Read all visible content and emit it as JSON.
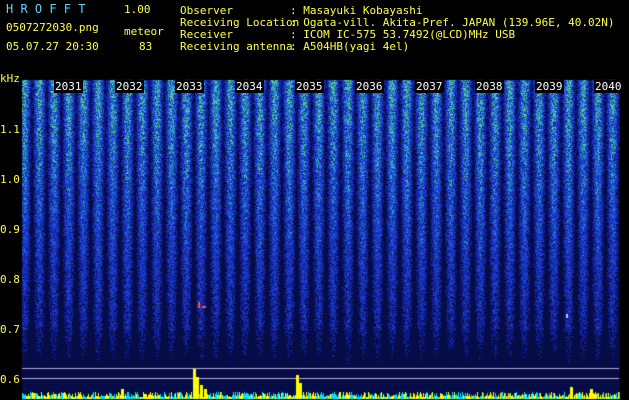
{
  "app": {
    "logo": "H R O F F T",
    "version": "1.00",
    "filename": "0507272030.png",
    "mode": "meteor",
    "datetime": "05.07.27 20:30",
    "count": "83"
  },
  "info": {
    "observer_label": "Observer",
    "observer_value": ": Masayuki Kobayashi",
    "location_label": "Receiving Location",
    "location_value": ": Ogata-vill. Akita-Pref. JAPAN (139.96E, 40.02N)",
    "receiver_label": "Receiver",
    "receiver_value": ": ICOM IC-575 53.7492(@LCD)MHz USB",
    "antenna_label": "Receiving antenna",
    "antenna_value": ": A504HB(yagi 4el)"
  },
  "axis": {
    "unit": "kHz",
    "y_ticks": [
      "1.1",
      "1.0",
      "0.9",
      "0.8",
      "0.7",
      "0.6"
    ],
    "time_ticks": [
      "2031",
      "2032",
      "2033",
      "2034",
      "2035",
      "2036",
      "2037",
      "2038",
      "2039",
      "2040"
    ]
  },
  "colors": {
    "background": "#000000",
    "header_cyan": "#5fd3ff",
    "header_yellow": "#ffff4a",
    "spectrogram_base": "#1a2f9a",
    "spectrogram_high": "#4ad0a0",
    "level_bar": "#ffff00",
    "level_bar_alt": "#00e5ff"
  }
}
